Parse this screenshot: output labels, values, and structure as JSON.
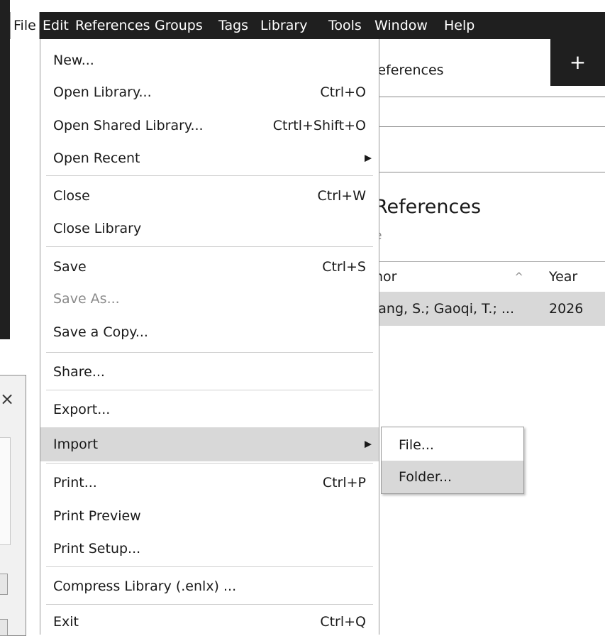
{
  "menubar": {
    "items": [
      {
        "label": "File"
      },
      {
        "label": "Edit"
      },
      {
        "label": "References"
      },
      {
        "label": "Groups"
      },
      {
        "label": "Tags"
      },
      {
        "label": "Library"
      },
      {
        "label": "Tools"
      },
      {
        "label": "Window"
      },
      {
        "label": "Help"
      }
    ]
  },
  "background": {
    "tab_title": "References",
    "tab_plus": "+",
    "heading": "References",
    "subheading": "e",
    "table": {
      "author_header": "hor",
      "year_header": "Year",
      "sort_icon": "^",
      "row": {
        "author": "iang, S.; Gaoqi, T.; ...",
        "year": "2026"
      }
    },
    "dialog_close": "×"
  },
  "file_menu": {
    "items": [
      {
        "label": "New...",
        "shortcut": ""
      },
      {
        "label": "Open Library...",
        "shortcut": "Ctrl+O"
      },
      {
        "label": "Open Shared Library...",
        "shortcut": "Ctrtl+Shift+O"
      },
      {
        "label": "Open Recent",
        "shortcut": "",
        "arrow": "▶"
      },
      {
        "label": "Close",
        "shortcut": "Ctrl+W"
      },
      {
        "label": "Close Library",
        "shortcut": ""
      },
      {
        "label": "Save",
        "shortcut": "Ctrl+S"
      },
      {
        "label": "Save As...",
        "shortcut": ""
      },
      {
        "label": "Save a Copy...",
        "shortcut": ""
      },
      {
        "label": "Share...",
        "shortcut": ""
      },
      {
        "label": "Export...",
        "shortcut": ""
      },
      {
        "label": "Import",
        "shortcut": "",
        "arrow": "▶"
      },
      {
        "label": "Print...",
        "shortcut": "Ctrl+P"
      },
      {
        "label": "Print Preview",
        "shortcut": ""
      },
      {
        "label": "Print Setup...",
        "shortcut": ""
      },
      {
        "label": "Compress Library (.enlx) ...",
        "shortcut": ""
      },
      {
        "label": "Exit",
        "shortcut": "Ctrl+Q"
      }
    ]
  },
  "import_submenu": {
    "items": [
      {
        "label": "File..."
      },
      {
        "label": "Folder..."
      }
    ]
  },
  "colors": {
    "menubar_bg": "#1f1f1f",
    "highlight": "#d8d8d8",
    "disabled_text": "#8a8a8a",
    "accent_teal": "#1f8a8a"
  }
}
